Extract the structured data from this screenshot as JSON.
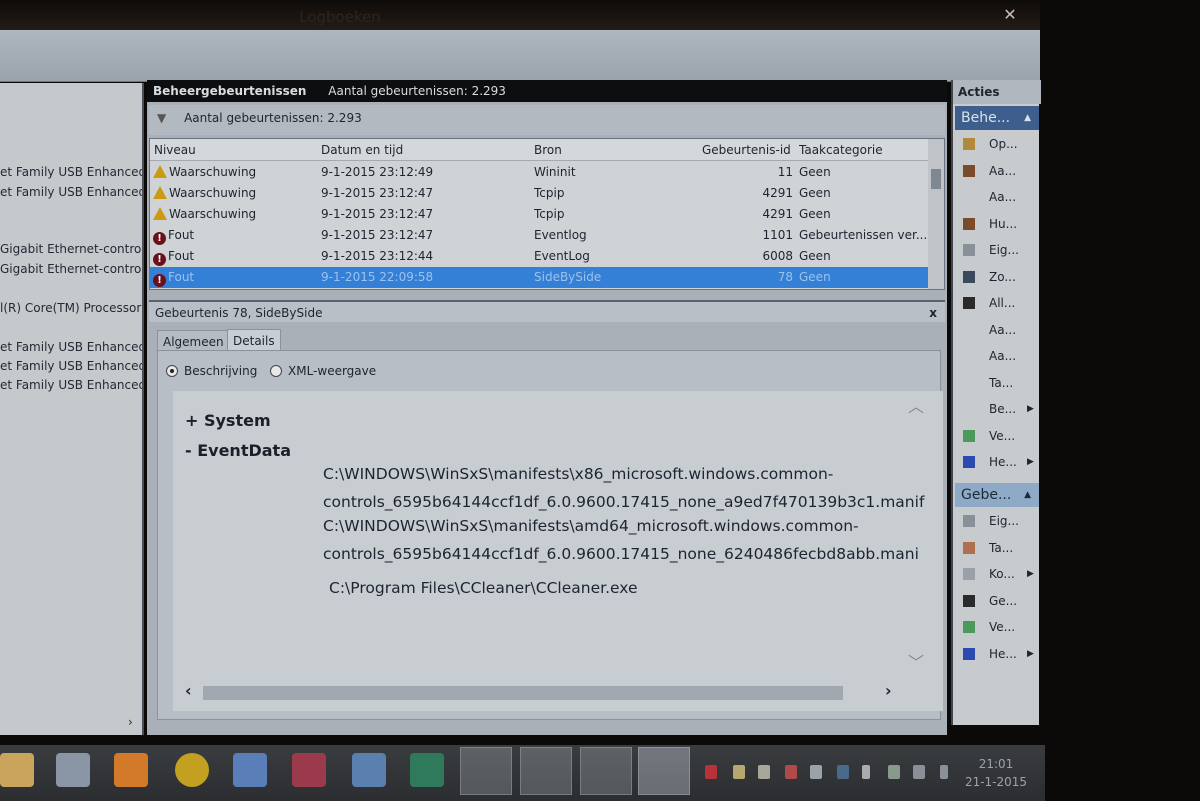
{
  "window": {
    "title": "Logboeken",
    "close": "✕"
  },
  "left_pane": {
    "items": [
      "et Family USB Enhanced",
      "et Family USB Enhanced",
      "Gigabit Ethernet-controll",
      "Gigabit Ethernet-controll",
      "l(R) Core(TM) Processor",
      "et Family USB Enhanced",
      "et Family USB Enhanced",
      "et Family USB Enhanced"
    ],
    "scroll_arrow": "›"
  },
  "center": {
    "header_title": "Beheergebeurtenissen",
    "header_count": "Aantal gebeurtenissen: 2.293",
    "filter_text": "Aantal gebeurtenissen: 2.293",
    "columns": [
      "Niveau",
      "Datum en tijd",
      "Bron",
      "Gebeurtenis-id",
      "Taakcategorie"
    ],
    "rows": [
      {
        "level": "Waarschuwing",
        "icon": "warning-icon",
        "date": "9-1-2015 23:12:49",
        "source": "Wininit",
        "id": "11",
        "category": "Geen"
      },
      {
        "level": "Waarschuwing",
        "icon": "warning-icon",
        "date": "9-1-2015 23:12:47",
        "source": "Tcpip",
        "id": "4291",
        "category": "Geen"
      },
      {
        "level": "Waarschuwing",
        "icon": "warning-icon",
        "date": "9-1-2015 23:12:47",
        "source": "Tcpip",
        "id": "4291",
        "category": "Geen"
      },
      {
        "level": "Fout",
        "icon": "error-icon",
        "date": "9-1-2015 23:12:47",
        "source": "Eventlog",
        "id": "1101",
        "category": "Gebeurtenissen ver..."
      },
      {
        "level": "Fout",
        "icon": "error-icon",
        "date": "9-1-2015 23:12:44",
        "source": "EventLog",
        "id": "6008",
        "category": "Geen"
      },
      {
        "level": "Fout",
        "icon": "error-icon",
        "date": "9-1-2015 22:09:58",
        "source": "SideBySide",
        "id": "78",
        "category": "Geen",
        "selected": true
      }
    ],
    "detail": {
      "title": "Gebeurtenis 78, SideBySide",
      "close": "x",
      "tabs": [
        "Algemeen",
        "Details"
      ],
      "active_tab": "Details",
      "radios": [
        "Beschrijving",
        "XML-weergave"
      ],
      "selected_radio": "Beschrijving",
      "system": "+ System",
      "eventdata": "-  EventData",
      "lines": [
        "C:\\WINDOWS\\WinSxS\\manifests\\x86_microsoft.windows.common-",
        "controls_6595b64144ccf1df_6.0.9600.17415_none_a9ed7f470139b3c1.manif",
        "C:\\WINDOWS\\WinSxS\\manifests\\amd64_microsoft.windows.common-",
        "controls_6595b64144ccf1df_6.0.9600.17415_none_6240486fecbd8abb.mani",
        "C:\\Program Files\\CCleaner\\CCleaner.exe"
      ]
    }
  },
  "actions": {
    "title": "Acties",
    "group1": "Behe...",
    "group1_items": [
      {
        "label": "Op...",
        "icon": "open-folder-icon"
      },
      {
        "label": "Aa...",
        "icon": "filter-icon"
      },
      {
        "label": "Aa...",
        "icon": ""
      },
      {
        "label": "Hu...",
        "icon": "filter-icon"
      },
      {
        "label": "Eig...",
        "icon": "properties-icon"
      },
      {
        "label": "Zo...",
        "icon": "find-icon"
      },
      {
        "label": "All...",
        "icon": "save-icon"
      },
      {
        "label": "Aa...",
        "icon": ""
      },
      {
        "label": "Aa...",
        "icon": ""
      },
      {
        "label": "Ta...",
        "icon": ""
      },
      {
        "label": "Be...",
        "icon": "",
        "submenu": true
      },
      {
        "label": "Ve...",
        "icon": "refresh-icon"
      },
      {
        "label": "He...",
        "icon": "help-icon",
        "submenu": true
      }
    ],
    "group2": "Gebe...",
    "group2_items": [
      {
        "label": "Eig...",
        "icon": "properties-icon"
      },
      {
        "label": "Ta...",
        "icon": "task-icon"
      },
      {
        "label": "Ko...",
        "icon": "copy-icon",
        "submenu": true
      },
      {
        "label": "Ge...",
        "icon": "save-icon"
      },
      {
        "label": "Ve...",
        "icon": "refresh-icon"
      },
      {
        "label": "He...",
        "icon": "help-icon",
        "submenu": true
      }
    ]
  },
  "taskbar": {
    "time": "21:01",
    "date": "21-1-2015"
  },
  "colors": {
    "selection": "#3480d6",
    "header": "#0d0e10",
    "action_group": "#3e5f8e"
  }
}
